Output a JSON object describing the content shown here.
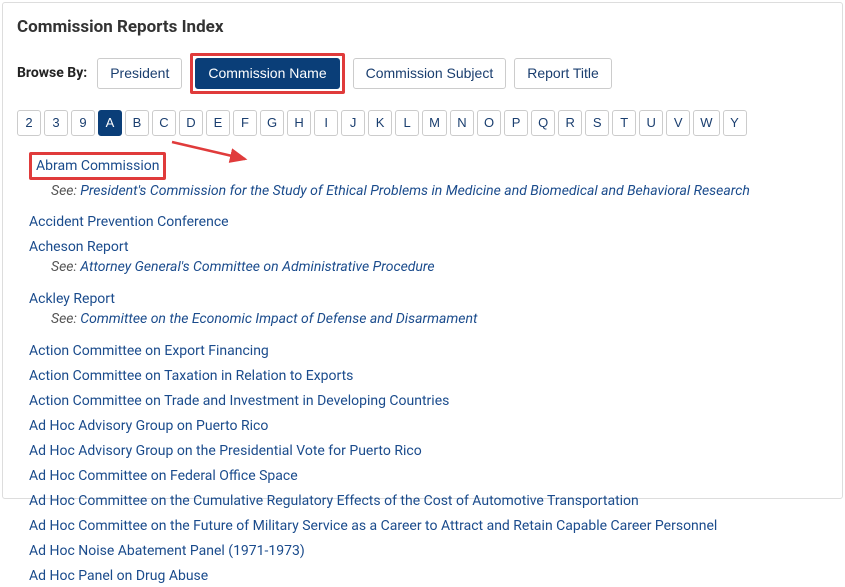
{
  "title": "Commission Reports Index",
  "browse_label": "Browse By:",
  "tabs": [
    {
      "label": "President",
      "active": false
    },
    {
      "label": "Commission Name",
      "active": true
    },
    {
      "label": "Commission Subject",
      "active": false
    },
    {
      "label": "Report Title",
      "active": false
    }
  ],
  "alpha": [
    "2",
    "3",
    "9",
    "A",
    "B",
    "C",
    "D",
    "E",
    "F",
    "G",
    "H",
    "I",
    "J",
    "K",
    "L",
    "M",
    "N",
    "O",
    "P",
    "Q",
    "R",
    "S",
    "T",
    "U",
    "V",
    "W",
    "Y"
  ],
  "alpha_active": "A",
  "see_prefix": "See: ",
  "entries": [
    {
      "title": "Abram Commission",
      "see": "President's Commission for the Study of Ethical Problems in Medicine and Biomedical and Behavioral Research",
      "highlighted": true
    },
    {
      "title": "Accident Prevention Conference"
    },
    {
      "title": "Acheson Report",
      "see": "Attorney General's Committee on Administrative Procedure"
    },
    {
      "title": "Ackley Report",
      "see": "Committee on the Economic Impact of Defense and Disarmament"
    },
    {
      "title": "Action Committee on Export Financing"
    },
    {
      "title": "Action Committee on Taxation in Relation to Exports"
    },
    {
      "title": "Action Committee on Trade and Investment in Developing Countries"
    },
    {
      "title": "Ad Hoc Advisory Group on Puerto Rico"
    },
    {
      "title": "Ad Hoc Advisory Group on the Presidential Vote for Puerto Rico"
    },
    {
      "title": "Ad Hoc Committee on Federal Office Space"
    },
    {
      "title": "Ad Hoc Committee on the Cumulative Regulatory Effects of the Cost of Automotive Transportation"
    },
    {
      "title": "Ad Hoc Committee on the Future of Military Service as a Career to Attract and Retain Capable Career Personnel"
    },
    {
      "title": "Ad Hoc Noise Abatement Panel (1971-1973)"
    },
    {
      "title": "Ad Hoc Panel on Drug Abuse"
    }
  ],
  "annotation_color": "#e03b3b"
}
